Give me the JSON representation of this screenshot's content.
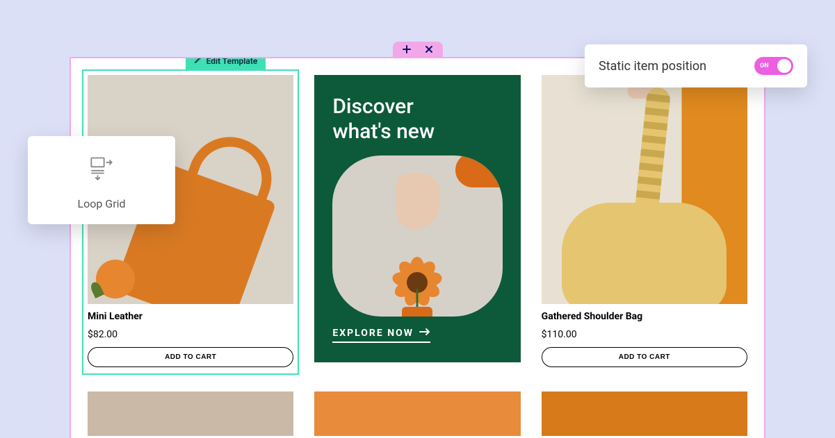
{
  "handle": {
    "icons": [
      "plus",
      "drag",
      "close"
    ]
  },
  "edit_badge": "Edit Template",
  "widget": {
    "name": "Loop Grid"
  },
  "setting": {
    "label": "Static item position",
    "state": "ON"
  },
  "promo": {
    "headline_line1": "Discover",
    "headline_line2": "what's new",
    "cta": "EXPLORE NOW"
  },
  "products": [
    {
      "title": "Mini Leather",
      "price": "$82.00",
      "button": "ADD TO CART"
    },
    {
      "title": "Gathered Shoulder Bag",
      "price": "$110.00",
      "button": "ADD TO CART"
    }
  ]
}
